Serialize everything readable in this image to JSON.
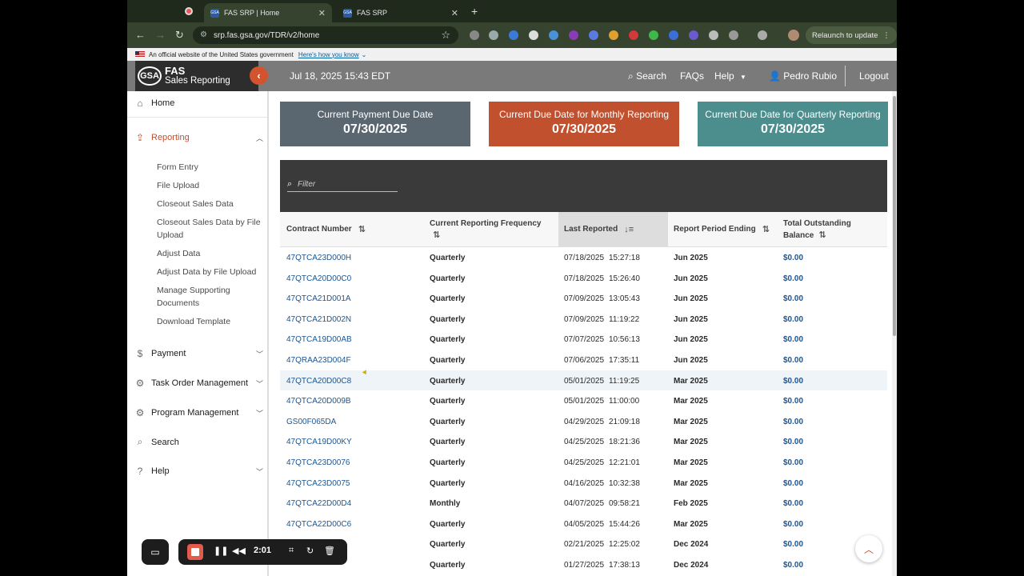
{
  "browser": {
    "tabs": [
      {
        "title": "FAS SRP | Home",
        "favicon": "gsa-favicon",
        "active": true
      },
      {
        "title": "FAS SRP",
        "favicon": "gsa-favicon",
        "active": false
      }
    ],
    "url": "srp.fas.gsa.gov/TDR/v2/home",
    "relaunch_label": "Relaunch to update"
  },
  "gov_banner": {
    "text": "An official website of the United States government",
    "link": "Here's how you know"
  },
  "header": {
    "logo_mark": "GSA",
    "logo_line1": "FAS",
    "logo_line2": "Sales Reporting",
    "datetime": "Jul 18, 2025 15:43 EDT",
    "search": "Search",
    "faqs": "FAQs",
    "help": "Help",
    "user": "Pedro Rubio",
    "logout": "Logout"
  },
  "sidebar": {
    "home": "Home",
    "reporting": "Reporting",
    "reporting_items": [
      "Form Entry",
      "File Upload",
      "Closeout Sales Data",
      "Closeout Sales Data by File Upload",
      "Adjust Data",
      "Adjust Data by File Upload",
      "Manage Supporting Documents",
      "Download Template"
    ],
    "payment": "Payment",
    "task_order": "Task Order Management",
    "program": "Program Management",
    "search": "Search",
    "help": "Help"
  },
  "cards": [
    {
      "title": "Current Payment Due Date",
      "date": "07/30/2025",
      "color": "#5b6770"
    },
    {
      "title": "Current Due Date for Monthly Reporting",
      "date": "07/30/2025",
      "color": "#c1502e"
    },
    {
      "title": "Current Due Date for Quarterly Reporting",
      "date": "07/30/2025",
      "color": "#4b8e8d"
    }
  ],
  "table": {
    "filter_placeholder": "Filter",
    "columns": [
      "Contract Number",
      "Current Reporting Frequency",
      "Last Reported",
      "Report Period Ending",
      "Total Outstanding Balance"
    ],
    "rows": [
      {
        "contract": "47QTCA23D000H",
        "freq": "Quarterly",
        "date": "07/18/2025",
        "time": "15:27:18",
        "period": "Jun 2025",
        "balance": "$0.00"
      },
      {
        "contract": "47QTCA20D00C0",
        "freq": "Quarterly",
        "date": "07/18/2025",
        "time": "15:26:40",
        "period": "Jun 2025",
        "balance": "$0.00"
      },
      {
        "contract": "47QTCA21D001A",
        "freq": "Quarterly",
        "date": "07/09/2025",
        "time": "13:05:43",
        "period": "Jun 2025",
        "balance": "$0.00"
      },
      {
        "contract": "47QTCA21D002N",
        "freq": "Quarterly",
        "date": "07/09/2025",
        "time": "11:19:22",
        "period": "Jun 2025",
        "balance": "$0.00"
      },
      {
        "contract": "47QTCA19D00AB",
        "freq": "Quarterly",
        "date": "07/07/2025",
        "time": "10:56:13",
        "period": "Jun 2025",
        "balance": "$0.00"
      },
      {
        "contract": "47QRAA23D004F",
        "freq": "Quarterly",
        "date": "07/06/2025",
        "time": "17:35:11",
        "period": "Jun 2025",
        "balance": "$0.00"
      },
      {
        "contract": "47QTCA20D00C8",
        "freq": "Quarterly",
        "date": "05/01/2025",
        "time": "11:19:25",
        "period": "Mar 2025",
        "balance": "$0.00"
      },
      {
        "contract": "47QTCA20D009B",
        "freq": "Quarterly",
        "date": "05/01/2025",
        "time": "11:00:00",
        "period": "Mar 2025",
        "balance": "$0.00"
      },
      {
        "contract": "GS00F065DA",
        "freq": "Quarterly",
        "date": "04/29/2025",
        "time": "21:09:18",
        "period": "Mar 2025",
        "balance": "$0.00"
      },
      {
        "contract": "47QTCA19D00KY",
        "freq": "Quarterly",
        "date": "04/25/2025",
        "time": "18:21:36",
        "period": "Mar 2025",
        "balance": "$0.00"
      },
      {
        "contract": "47QTCA23D0076",
        "freq": "Quarterly",
        "date": "04/25/2025",
        "time": "12:21:01",
        "period": "Mar 2025",
        "balance": "$0.00"
      },
      {
        "contract": "47QTCA23D0075",
        "freq": "Quarterly",
        "date": "04/16/2025",
        "time": "10:32:38",
        "period": "Mar 2025",
        "balance": "$0.00"
      },
      {
        "contract": "47QTCA22D00D4",
        "freq": "Monthly",
        "date": "04/07/2025",
        "time": "09:58:21",
        "period": "Feb 2025",
        "balance": "$0.00"
      },
      {
        "contract": "47QTCA22D00C6",
        "freq": "Quarterly",
        "date": "04/05/2025",
        "time": "15:44:26",
        "period": "Mar 2025",
        "balance": "$0.00"
      },
      {
        "contract": "",
        "freq": "Quarterly",
        "date": "02/21/2025",
        "time": "12:25:02",
        "period": "Dec 2024",
        "balance": "$0.00"
      },
      {
        "contract": "",
        "freq": "Quarterly",
        "date": "01/27/2025",
        "time": "17:38:13",
        "period": "Dec 2024",
        "balance": "$0.00"
      }
    ]
  },
  "recorder": {
    "time": "2:01"
  }
}
